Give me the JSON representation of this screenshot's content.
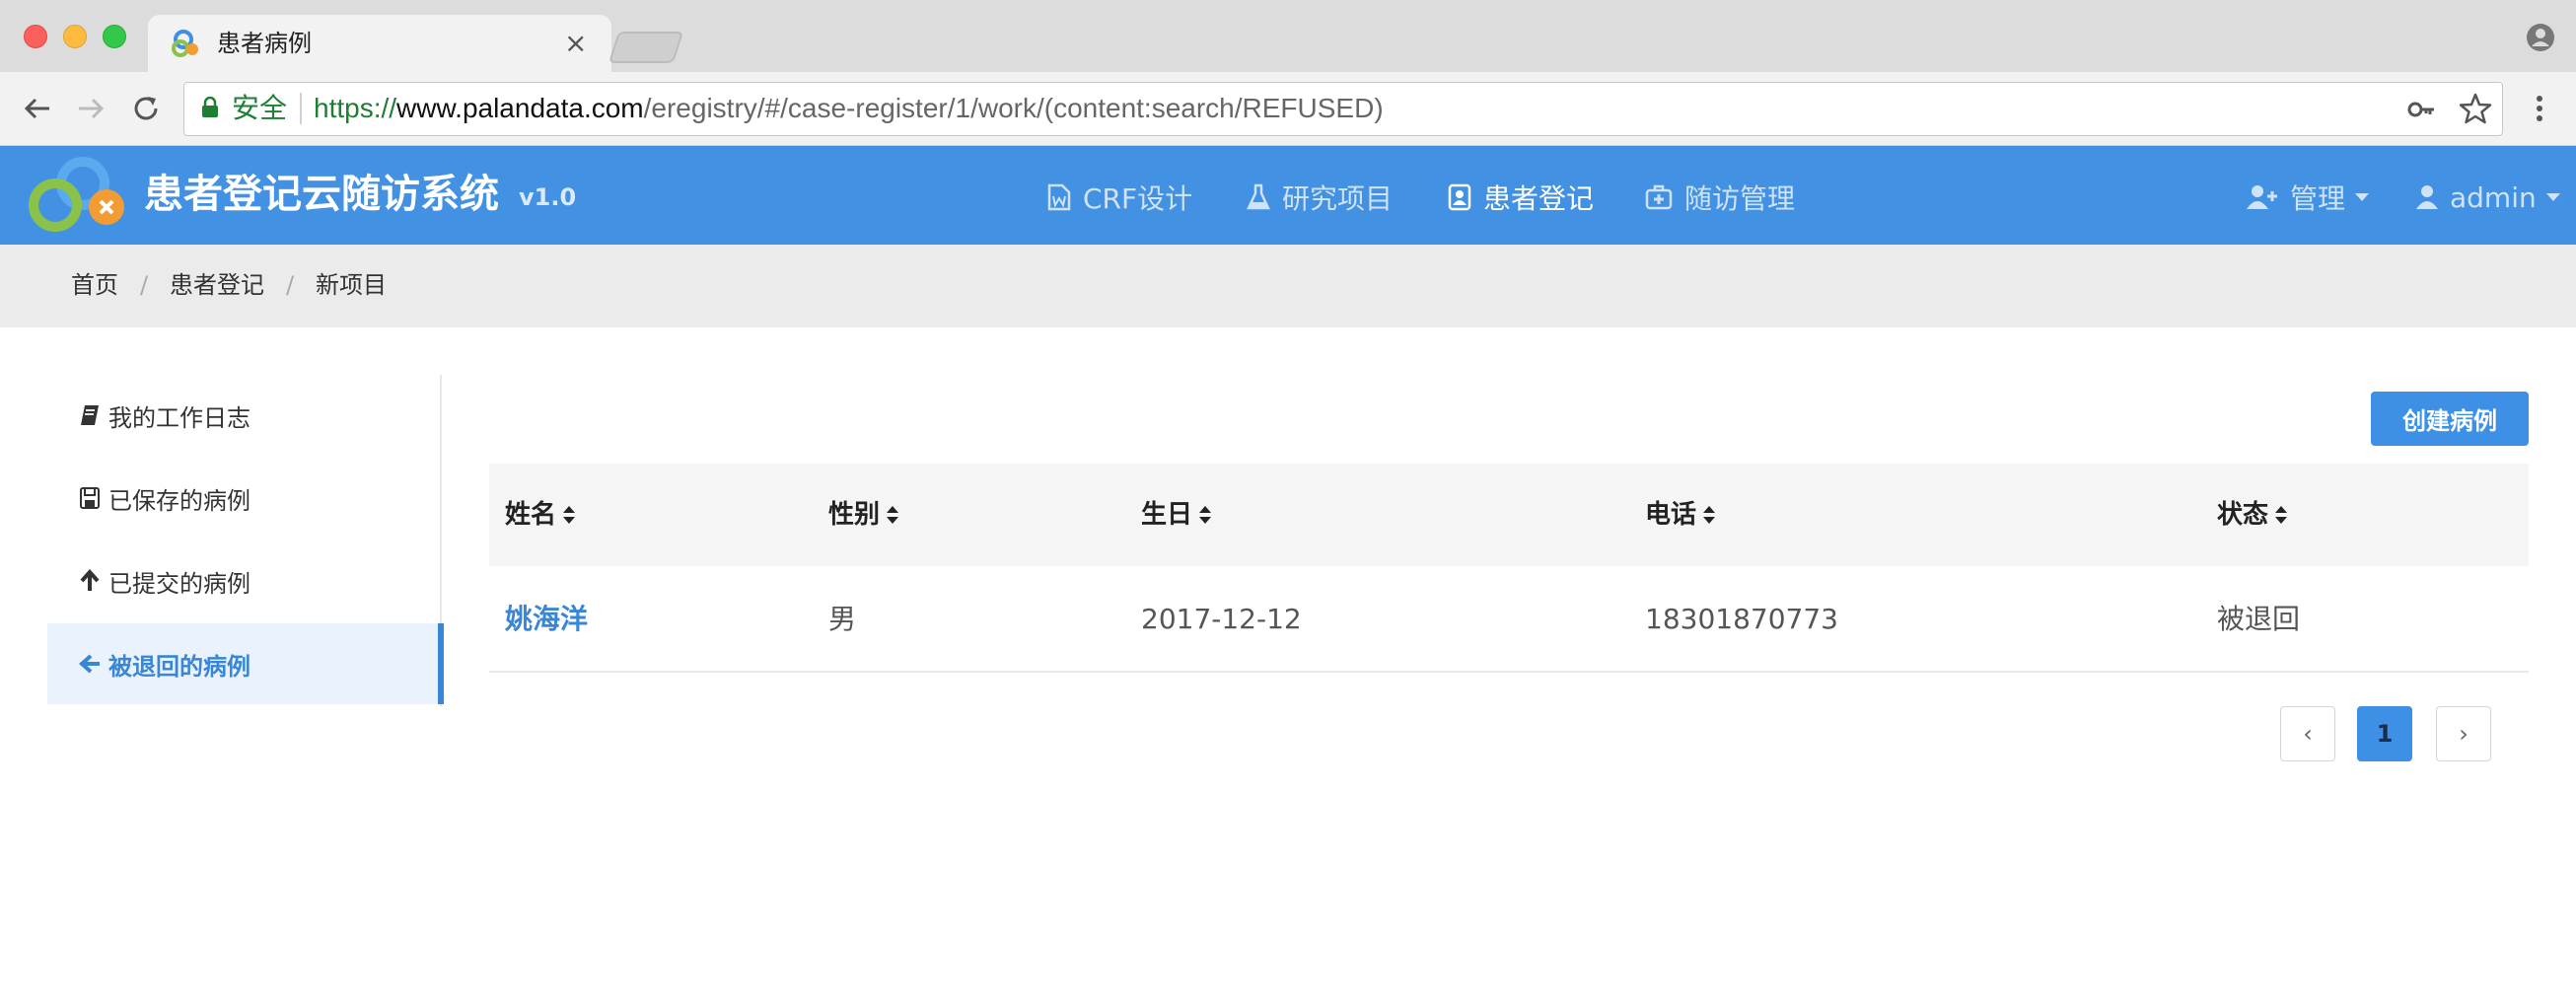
{
  "browser": {
    "tab_title": "患者病例",
    "tab_close": "×",
    "secure_label": "安全",
    "url_scheme": "https://",
    "url_host": "www.palandata.com",
    "url_path": "/eregistry/#/case-register/1/work/(content:search/REFUSED)"
  },
  "header": {
    "title": "患者登记云随访系统",
    "version": "v1.0",
    "nav": [
      {
        "label": "CRF设计",
        "icon": "file-word-icon",
        "active": false
      },
      {
        "label": "研究项目",
        "icon": "flask-icon",
        "active": false
      },
      {
        "label": "患者登记",
        "icon": "address-book-icon",
        "active": true
      },
      {
        "label": "随访管理",
        "icon": "medkit-icon",
        "active": false
      }
    ],
    "admin_menu": {
      "label": "管理",
      "icon": "user-plus-icon"
    },
    "user_menu": {
      "label": "admin",
      "icon": "user-icon"
    }
  },
  "breadcrumb": [
    "首页",
    "患者登记",
    "新项目"
  ],
  "breadcrumb_separator": "/",
  "sidebar": {
    "items": [
      {
        "label": "我的工作日志",
        "icon": "book-icon",
        "active": false
      },
      {
        "label": "已保存的病例",
        "icon": "save-icon",
        "active": false
      },
      {
        "label": "已提交的病例",
        "icon": "arrow-up-icon",
        "active": false
      },
      {
        "label": "被退回的病例",
        "icon": "arrow-left-icon",
        "active": true
      }
    ]
  },
  "actions": {
    "create_case": "创建病例"
  },
  "table": {
    "columns": [
      "姓名",
      "性别",
      "生日",
      "电话",
      "状态"
    ],
    "rows": [
      {
        "name": "姚海洋",
        "gender": "男",
        "birthday": "2017-12-12",
        "phone": "18301870773",
        "status": "被退回"
      }
    ]
  },
  "pagination": {
    "prev": "‹",
    "current": "1",
    "next": "›"
  },
  "colors": {
    "header_bg": "#4291e2",
    "accent": "#3e8fe6",
    "link": "#3a86d6"
  }
}
